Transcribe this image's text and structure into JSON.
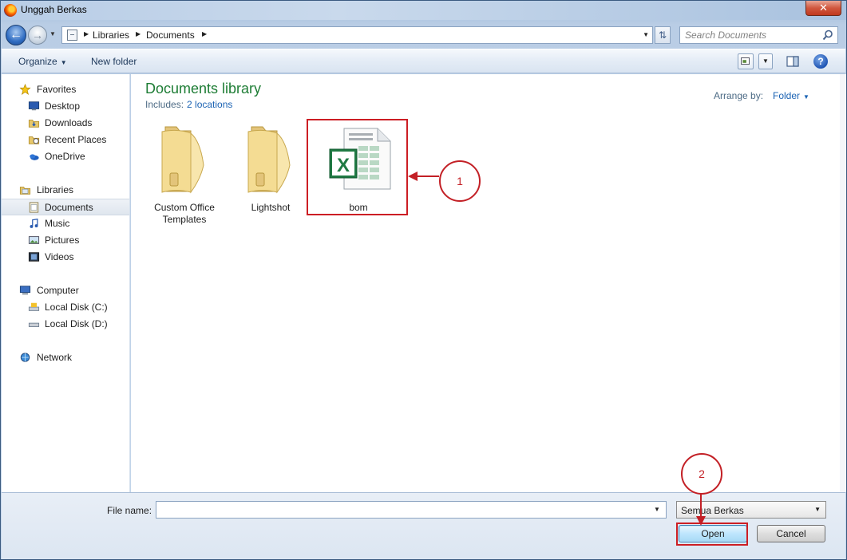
{
  "window": {
    "title": "Unggah Berkas",
    "close_glyph": "✕"
  },
  "address": {
    "breadcrumbs": [
      "Libraries",
      "Documents"
    ],
    "search_placeholder": "Search Documents"
  },
  "toolbar": {
    "organize": "Organize",
    "new_folder": "New folder",
    "help": "?"
  },
  "nav": {
    "groups": [
      {
        "label": "Favorites",
        "icon": "star-icon",
        "items": [
          {
            "label": "Desktop",
            "icon": "desktop-icon"
          },
          {
            "label": "Downloads",
            "icon": "downloads-icon"
          },
          {
            "label": "Recent Places",
            "icon": "recent-places-icon"
          },
          {
            "label": "OneDrive",
            "icon": "onedrive-icon"
          }
        ]
      },
      {
        "label": "Libraries",
        "icon": "libraries-icon",
        "items": [
          {
            "label": "Documents",
            "icon": "documents-icon",
            "selected": true
          },
          {
            "label": "Music",
            "icon": "music-icon"
          },
          {
            "label": "Pictures",
            "icon": "pictures-icon"
          },
          {
            "label": "Videos",
            "icon": "videos-icon"
          }
        ]
      },
      {
        "label": "Computer",
        "icon": "computer-icon",
        "items": [
          {
            "label": "Local Disk (C:)",
            "icon": "disk-c-icon"
          },
          {
            "label": "Local Disk (D:)",
            "icon": "disk-d-icon"
          }
        ]
      },
      {
        "label": "Network",
        "icon": "network-icon",
        "items": []
      }
    ]
  },
  "content": {
    "title": "Documents library",
    "includes_label": "Includes:",
    "includes_link": "2 locations",
    "arrange_label": "Arrange by:",
    "arrange_value": "Folder",
    "files": [
      {
        "label_line1": "Custom Office",
        "label_line2": "Templates",
        "type": "folder"
      },
      {
        "label_line1": "Lightshot",
        "label_line2": "",
        "type": "folder"
      },
      {
        "label_line1": "bom",
        "label_line2": "",
        "type": "excel"
      }
    ],
    "callouts": [
      "1",
      "2"
    ]
  },
  "bottom": {
    "file_name_label": "File name:",
    "file_name_value": "",
    "file_type": "Semua Berkas",
    "open_label": "Open",
    "cancel_label": "Cancel"
  },
  "colors": {
    "accent_red": "#c32026",
    "library_green": "#1e7d35",
    "link_blue": "#1a62b3"
  }
}
